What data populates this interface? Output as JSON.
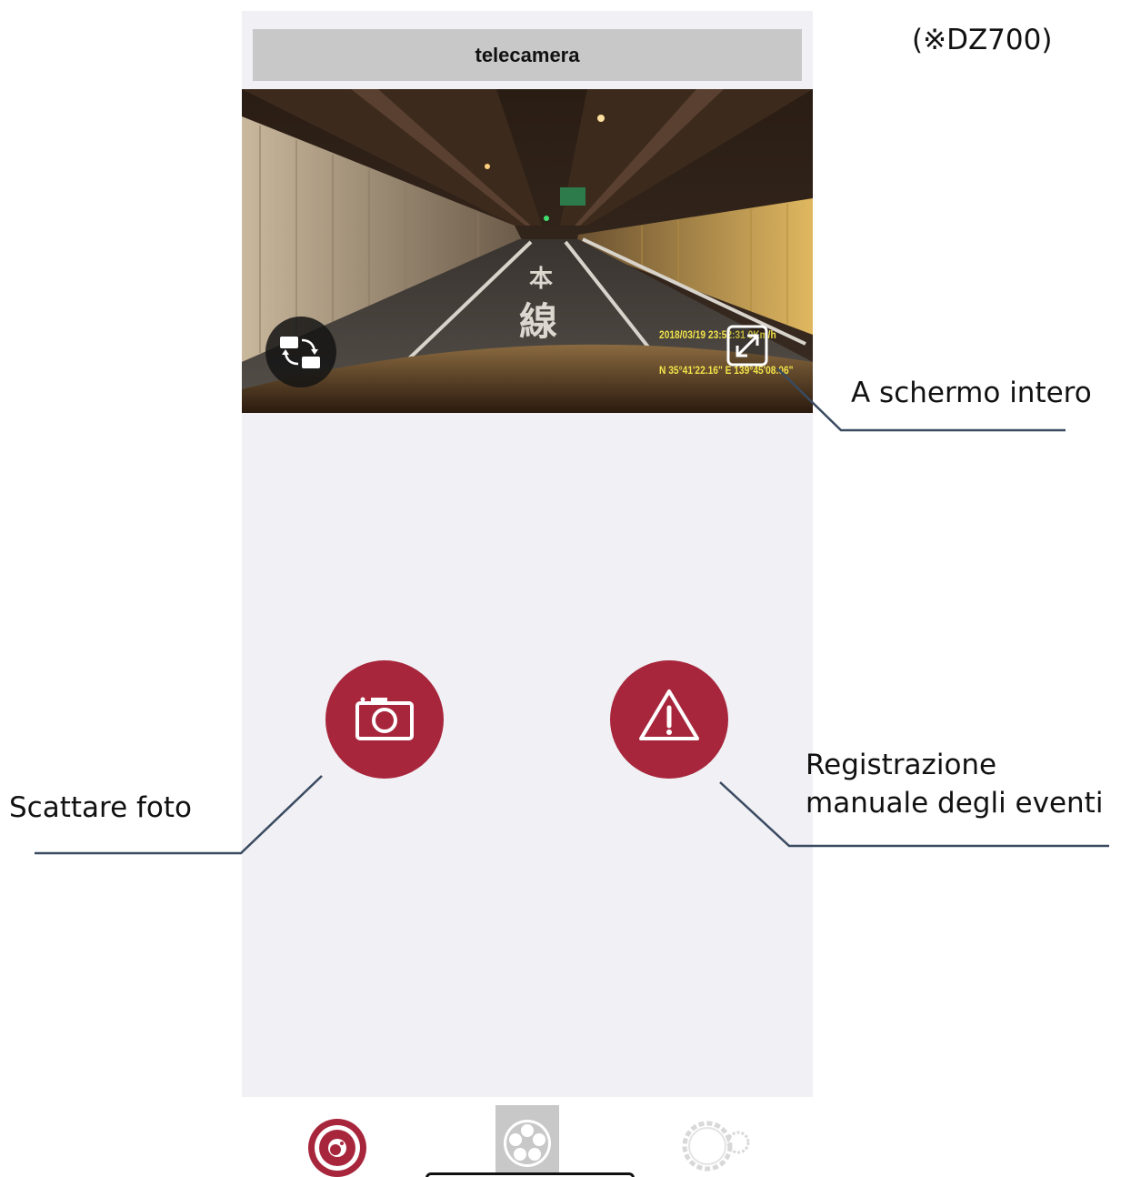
{
  "header": {
    "title": "telecamera"
  },
  "model_note": "(※DZ700)",
  "video": {
    "timestamp_line1": "2018/03/19   23:52:31  0Km/h",
    "timestamp_line2": "N 35°41'22.16\"  E 139°45'08.06\"",
    "road_marking_1": "本",
    "road_marking_2": "線"
  },
  "annotations": {
    "fullscreen": "A schermo intero",
    "take_photo": "Scattare foto",
    "event_line1": "Registrazione",
    "event_line2": "manuale degli eventi"
  },
  "icons": {
    "swap": "swap-camera-icon",
    "fullscreen": "fullscreen-icon",
    "photo": "camera-icon",
    "event": "warning-icon",
    "tab_camera": "record-icon",
    "tab_media": "film-reel-icon",
    "tab_settings": "gear-icon"
  },
  "colors": {
    "accent": "#a8263c",
    "overlay_text": "#f2e34a",
    "leader_line": "#3a4a60"
  }
}
